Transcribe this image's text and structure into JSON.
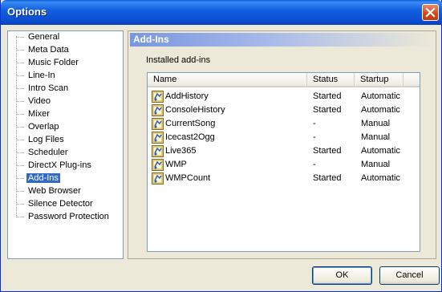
{
  "window": {
    "title": "Options"
  },
  "tree": {
    "items": [
      {
        "label": "General"
      },
      {
        "label": "Meta Data"
      },
      {
        "label": "Music Folder"
      },
      {
        "label": "Line-In"
      },
      {
        "label": "Intro Scan"
      },
      {
        "label": "Video"
      },
      {
        "label": "Mixer"
      },
      {
        "label": "Overlap"
      },
      {
        "label": "Log Files"
      },
      {
        "label": "Scheduler"
      },
      {
        "label": "DirectX Plug-ins"
      },
      {
        "label": "Add-Ins",
        "selected": true
      },
      {
        "label": "Web Browser"
      },
      {
        "label": "Silence Detector"
      },
      {
        "label": "Password Protection"
      }
    ]
  },
  "panel": {
    "header": "Add-Ins",
    "installed_label": "Installed add-ins",
    "columns": {
      "name": "Name",
      "status": "Status",
      "startup": "Startup"
    },
    "rows": [
      {
        "name": "AddHistory",
        "status": "Started",
        "startup": "Automatic",
        "icon": "plugin-icon"
      },
      {
        "name": "ConsoleHistory",
        "status": "Started",
        "startup": "Automatic",
        "icon": "plugin-icon"
      },
      {
        "name": "CurrentSong",
        "status": "-",
        "startup": "Manual",
        "icon": "plugin-icon"
      },
      {
        "name": "Icecast2Ogg",
        "status": "-",
        "startup": "Manual",
        "icon": "plugin-icon"
      },
      {
        "name": "Live365",
        "status": "Started",
        "startup": "Automatic",
        "icon": "plugin-icon"
      },
      {
        "name": "WMP",
        "status": "-",
        "startup": "Manual",
        "icon": "plugin-icon"
      },
      {
        "name": "WMPCount",
        "status": "Started",
        "startup": "Automatic",
        "icon": "plugin-icon"
      }
    ]
  },
  "buttons": {
    "ok": "OK",
    "cancel": "Cancel"
  },
  "colors": {
    "titlebar": "#0a5ad8",
    "selection": "#316ac5",
    "panel_header": "#7a96df"
  }
}
